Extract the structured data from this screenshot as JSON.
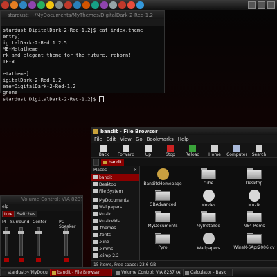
{
  "terminal": {
    "title": "~stardust: ~/MyDocuments/MyThemes/DigitalDark-2-Red-1.2",
    "lines": [
      "stardust DigitalDark-2-Red-1.2]$ cat index.theme",
      "entry]",
      "igitalDark-2-Red 1.2.5",
      "ME-Metatheme",
      "rk and elegant theme for the future, reborn!",
      "TF-8",
      "",
      "etatheme]",
      "igitalDark-2-Red-1.2",
      "eme=DigitalDark-2-Red-1.2",
      "gnome",
      "stardust DigitalDark-2-Red-1.2]$ "
    ]
  },
  "volume": {
    "title": "Volume Control: VIA 8237",
    "menu": "elp",
    "tabs": [
      "ture",
      "Switches"
    ],
    "channels": [
      {
        "label": "M",
        "level": 0.85
      },
      {
        "label": "Surround",
        "level": 0.85
      },
      {
        "label": "Center",
        "level": 0.85
      },
      {
        "label": "PC Speaker",
        "level": 0.85
      }
    ]
  },
  "file_browser": {
    "title": "bandit - File Browser",
    "menu": [
      "File",
      "Edit",
      "View",
      "Go",
      "Bookmarks",
      "Help"
    ],
    "toolbar": [
      {
        "label": "Back",
        "icon": "back-arrow-icon",
        "color": "#d8d8d8"
      },
      {
        "label": "Forward",
        "icon": "forward-arrow-icon",
        "color": "#d8d8d8"
      },
      {
        "label": "Up",
        "icon": "up-arrow-icon",
        "color": "#d8d8d8"
      },
      {
        "label": "Stop",
        "icon": "stop-icon",
        "color": "#cc2222"
      },
      {
        "label": "Reload",
        "icon": "reload-icon",
        "color": "#3aa33a"
      },
      {
        "label": "Home",
        "icon": "home-icon",
        "color": "#cfcfcf"
      },
      {
        "label": "Computer",
        "icon": "computer-icon",
        "color": "#a8b8d8"
      },
      {
        "label": "Search",
        "icon": "search-icon",
        "color": "#cfcfcf"
      }
    ],
    "location": "bandit",
    "sidebar_title": "Places",
    "sidebar_close": "×",
    "places": [
      "bandit",
      "Desktop",
      "File System",
      "",
      "MyDocuments",
      "Wallpapers",
      "Muzik",
      "MuzikVids",
      ".themes",
      ".fonts",
      ".xine",
      ".xmms",
      ".gimp-2.2"
    ],
    "items": [
      {
        "label": "BanditsHomepage",
        "kind": "special",
        "color": "#c9a040"
      },
      {
        "label": "cube",
        "kind": "folder",
        "color": "#bbbbbb"
      },
      {
        "label": "Desktop",
        "kind": "folder",
        "color": "#bbbbbb"
      },
      {
        "label": "GBAdvanced",
        "kind": "folder",
        "color": "#bbbbbb"
      },
      {
        "label": "Movies",
        "kind": "special",
        "color": "#d8d8d8"
      },
      {
        "label": "Muzik",
        "kind": "special",
        "color": "#d8d8d8"
      },
      {
        "label": "MyDocuments",
        "kind": "folder",
        "color": "#bbbbbb"
      },
      {
        "label": "MyInstalled",
        "kind": "folder",
        "color": "#bbbbbb"
      },
      {
        "label": "N64-Roms",
        "kind": "folder",
        "color": "#bbbbbb"
      },
      {
        "label": "Pyro",
        "kind": "folder",
        "color": "#bbbbbb"
      },
      {
        "label": "Wallpapers",
        "kind": "special",
        "color": "#c8c8c8"
      },
      {
        "label": "WineX-6Apr2006.cv",
        "kind": "folder",
        "color": "#bbbbbb"
      }
    ],
    "status": "15 items, Free space: 23.6 GB"
  },
  "taskbar": [
    {
      "label": "stardust:~/MyDocume...",
      "icon_color": "#222222",
      "active": false
    },
    {
      "label": "bandit - File Browser",
      "icon_color": "#caa33a",
      "active": true
    },
    {
      "label": "Volume Control: VIA 8237 (Alsa...",
      "icon_color": "#888888",
      "active": false
    },
    {
      "label": "Calculator - Basic",
      "icon_color": "#888888",
      "active": false
    }
  ],
  "top_panel": {
    "launcher_colors": [
      "#c0392b",
      "#e67e22",
      "#2e86c1",
      "#8e44ad",
      "#27ae60",
      "#f1c40f",
      "#7f8c8d",
      "#c0392b",
      "#2980b9",
      "#d35400",
      "#16a085",
      "#8e44ad",
      "#95a5a6",
      "#c0392b",
      "#e74c3c",
      "#3498db"
    ],
    "tray_icons": [
      "network-icon",
      "volume-icon",
      "clock-icon"
    ]
  },
  "colors": {
    "accent": "#8a0000",
    "background": "#000000"
  }
}
